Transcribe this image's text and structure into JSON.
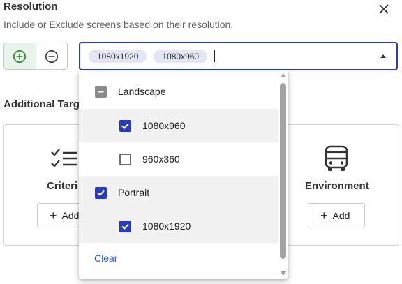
{
  "dialog": {
    "title": "Resolution",
    "subtitle": "Include or Exclude screens based on their resolution."
  },
  "mode": {
    "include_icon": "plus-circle-icon",
    "exclude_icon": "minus-circle-icon",
    "active": "include",
    "accent_color": "#2e7d32"
  },
  "select": {
    "chips": [
      "1080x1920",
      "1080x960"
    ],
    "accent_color": "#2a3cb5"
  },
  "additional": {
    "heading": "Additional Targ"
  },
  "cards": {
    "criteria": {
      "label": "Criteri",
      "add_label": "Add",
      "icon": "checklist-icon"
    },
    "environment": {
      "label": "Environment",
      "add_label": "Add",
      "icon": "bus-icon"
    }
  },
  "dropdown": {
    "groups": [
      {
        "label": "Landscape",
        "state": "indeterminate"
      },
      {
        "label": "Portrait",
        "state": "checked"
      }
    ],
    "options": [
      {
        "label": "1080x960",
        "checked": true
      },
      {
        "label": "960x360",
        "checked": false
      },
      {
        "label": "1080x1920",
        "checked": true
      }
    ],
    "clear_label": "Clear"
  }
}
